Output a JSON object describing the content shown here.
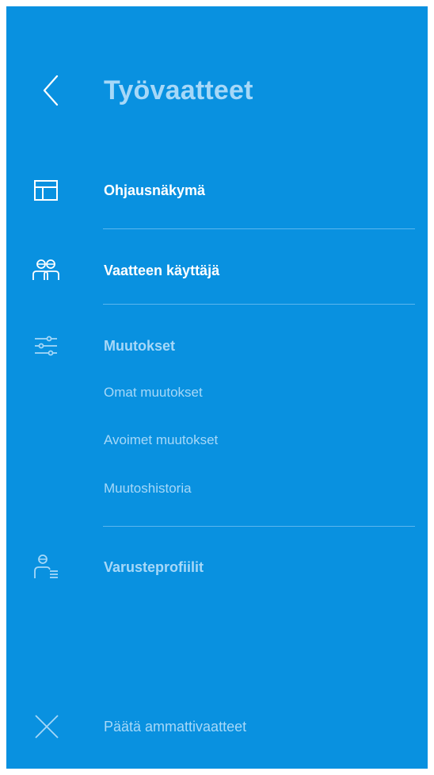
{
  "header": {
    "title": "Työvaatteet",
    "back_icon": "chevron-left-icon"
  },
  "nav": {
    "items": [
      {
        "label": "Ohjausnäkymä",
        "icon": "dashboard-layout-icon",
        "active": true
      },
      {
        "label": "Vaatteen käyttäjä",
        "icon": "users-icon",
        "active": true
      },
      {
        "label": "Muutokset",
        "icon": "sliders-icon",
        "active": false,
        "subitems": [
          "Omat muutokset",
          "Avoimet muutokset",
          "Muutoshistoria"
        ]
      },
      {
        "label": "Varusteprofiilit",
        "icon": "user-list-icon",
        "active": false
      }
    ]
  },
  "footer": {
    "close_label": "Päätä ammattivaatteet",
    "close_icon": "close-icon"
  },
  "colors": {
    "background": "#0991e0",
    "primary_text": "#ffffff",
    "muted_text": "#a6d8f8",
    "divider": "#5cb6ee"
  }
}
